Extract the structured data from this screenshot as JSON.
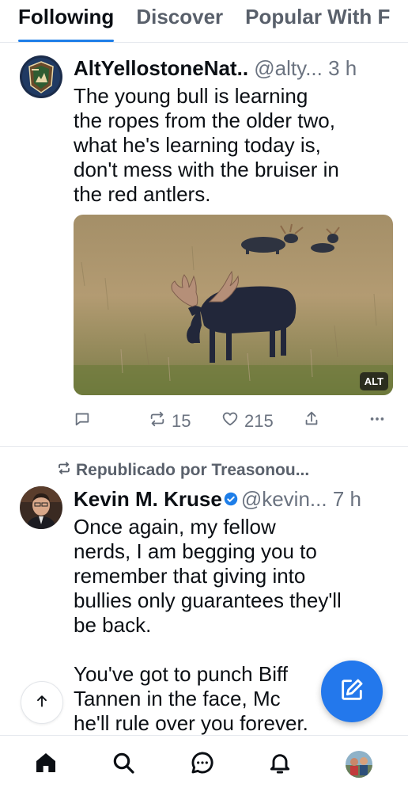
{
  "tabs": [
    "Following",
    "Discover",
    "Popular With F"
  ],
  "post1": {
    "author_name": "AltYellostoneNat..",
    "handle": "@alty...",
    "time": "3 h",
    "text": "The young bull is learning\nthe ropes from the older two,\nwhat he's learning today is,\ndon't mess with the bruiser in\nthe red antlers.",
    "image_alt_badge": "ALT",
    "reposts": "15",
    "likes": "215"
  },
  "post2": {
    "repost_label": "Republicado por Treasonou...",
    "author_name": "Kevin M. Kruse",
    "handle": "@kevin...",
    "time": "7 h",
    "text": "Once again, my fellow\nnerds, I am begging you to\nremember that giving into\nbullies only guarantees they'll\nbe back.\n\nYou've got to punch Biff\nTannen in the face, Mc\nhe'll rule over you forever."
  },
  "colors": {
    "accent": "#1e7ee8",
    "compose": "#2378ec",
    "muted": "#6b7380"
  },
  "icons": [
    "reply-icon",
    "repost-icon",
    "heart-icon",
    "share-icon",
    "more-icon",
    "arrow-up-icon",
    "compose-icon",
    "home-icon",
    "search-icon",
    "chat-icon",
    "bell-icon",
    "profile-avatar"
  ]
}
